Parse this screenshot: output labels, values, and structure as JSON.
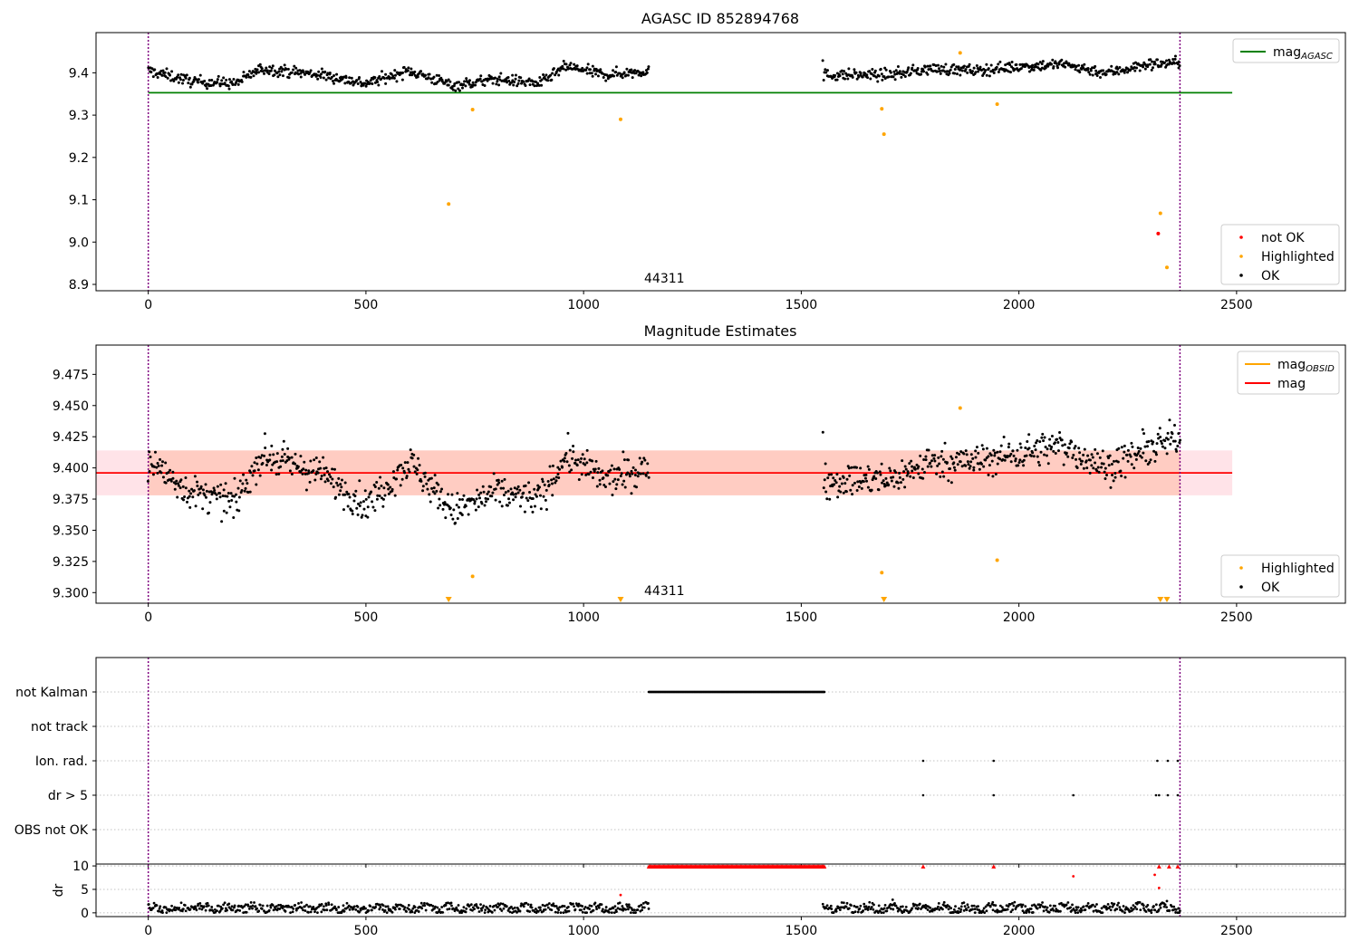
{
  "chart_data": [
    {
      "type": "scatter",
      "title": "AGASC ID 852894768",
      "xlabel": "",
      "ylabel": "",
      "xlim": [
        -120,
        2750
      ],
      "ylim": [
        8.885,
        9.495
      ],
      "xticks": [
        0,
        500,
        1000,
        1500,
        2000,
        2500
      ],
      "yticks": [
        8.9,
        9.0,
        9.1,
        9.2,
        9.3,
        9.4
      ],
      "ytick_labels": [
        "8.9",
        "9.0",
        "9.1",
        "9.2",
        "9.3",
        "9.4"
      ],
      "grid": false,
      "vlines": [
        0,
        2370
      ],
      "annotation": {
        "text": "44311",
        "x": 1180,
        "y": 8.905
      },
      "legends": [
        {
          "location": "upper right",
          "entries": [
            {
              "label": "mag",
              "subscript": "AGASC",
              "color": "#008000",
              "kind": "line"
            }
          ]
        },
        {
          "location": "lower right",
          "entries": [
            {
              "label": "not OK",
              "color": "#ff0000",
              "kind": "marker"
            },
            {
              "label": "Highlighted",
              "color": "#ffa500",
              "kind": "marker"
            },
            {
              "label": "OK",
              "color": "#000000",
              "kind": "marker"
            }
          ]
        }
      ],
      "hlines": [
        {
          "name": "mag_AGASC",
          "y": 9.353,
          "xrange": [
            0,
            2490
          ],
          "color": "#008000"
        }
      ],
      "series": [
        {
          "name": "OK",
          "color": "#000000",
          "kind": "scatter-dense",
          "segments": [
            {
              "x": [
                0,
                1150
              ],
              "y_anchors": [
                [
                  0,
                  9.405
                ],
                [
                  100,
                  9.38
                ],
                [
                  200,
                  9.375
                ],
                [
                  260,
                  9.41
                ],
                [
                  400,
                  9.395
                ],
                [
                  500,
                  9.375
                ],
                [
                  600,
                  9.405
                ],
                [
                  700,
                  9.37
                ],
                [
                  800,
                  9.385
                ],
                [
                  900,
                  9.375
                ],
                [
                  960,
                  9.415
                ],
                [
                  1050,
                  9.395
                ],
                [
                  1150,
                  9.405
                ]
              ],
              "spread": 0.012,
              "n": 620
            },
            {
              "x": [
                1550,
                2370
              ],
              "y_anchors": [
                [
                  1550,
                  9.395
                ],
                [
                  1700,
                  9.395
                ],
                [
                  1800,
                  9.41
                ],
                [
                  1900,
                  9.405
                ],
                [
                  2000,
                  9.415
                ],
                [
                  2100,
                  9.42
                ],
                [
                  2200,
                  9.4
                ],
                [
                  2300,
                  9.42
                ],
                [
                  2370,
                  9.425
                ]
              ],
              "spread": 0.012,
              "n": 440
            }
          ]
        },
        {
          "name": "Highlighted",
          "color": "#ffa500",
          "kind": "scatter",
          "x": [
            690,
            745,
            1085,
            1685,
            1690,
            1865,
            1950,
            2325,
            2340
          ],
          "y": [
            9.09,
            9.313,
            9.29,
            9.315,
            9.255,
            9.447,
            9.326,
            9.068,
            8.94
          ]
        },
        {
          "name": "not OK",
          "color": "#ff0000",
          "kind": "scatter",
          "x": [
            2320
          ],
          "y": [
            9.02
          ]
        }
      ]
    },
    {
      "type": "scatter",
      "title": "Magnitude Estimates",
      "xlabel": "",
      "ylabel": "",
      "xlim": [
        -120,
        2750
      ],
      "ylim": [
        9.2915,
        9.4985
      ],
      "xticks": [
        0,
        500,
        1000,
        1500,
        2000,
        2500
      ],
      "yticks": [
        9.3,
        9.325,
        9.35,
        9.375,
        9.4,
        9.425,
        9.45,
        9.475
      ],
      "ytick_labels": [
        "9.300",
        "9.325",
        "9.350",
        "9.375",
        "9.400",
        "9.425",
        "9.450",
        "9.475"
      ],
      "grid": false,
      "vlines": [
        0,
        2370
      ],
      "annotation": {
        "text": "44311",
        "x": 1180,
        "y": 9.296
      },
      "legends": [
        {
          "location": "upper right",
          "entries": [
            {
              "label": "mag",
              "subscript": "OBSID",
              "color": "#ffa500",
              "kind": "line"
            },
            {
              "label": "mag",
              "subscript": "",
              "color": "#ff0000",
              "kind": "line"
            }
          ]
        },
        {
          "location": "lower right",
          "entries": [
            {
              "label": "Highlighted",
              "color": "#ffa500",
              "kind": "marker"
            },
            {
              "label": "OK",
              "color": "#000000",
              "kind": "marker"
            }
          ]
        }
      ],
      "hlines": [
        {
          "name": "mag",
          "y": 9.396,
          "xrange": [
            -120,
            2490
          ],
          "color": "#ff0000"
        }
      ],
      "bands": [
        {
          "name": "mag_band",
          "y": [
            9.378,
            9.414
          ],
          "xrange": [
            -120,
            2490
          ],
          "color": "#ffc0cb",
          "opacity": 0.45
        },
        {
          "name": "mag_OBSID_band",
          "y": [
            9.378,
            9.414
          ],
          "xrange": [
            0,
            2370
          ],
          "color": "#ffa07a",
          "opacity": 0.35
        }
      ],
      "series": [
        {
          "name": "OK",
          "color": "#000000",
          "kind": "scatter-dense",
          "segments": [
            {
              "x": [
                0,
                1150
              ],
              "y_anchors": [
                [
                  0,
                  9.405
                ],
                [
                  100,
                  9.38
                ],
                [
                  200,
                  9.372
                ],
                [
                  260,
                  9.41
                ],
                [
                  400,
                  9.395
                ],
                [
                  500,
                  9.37
                ],
                [
                  600,
                  9.405
                ],
                [
                  700,
                  9.365
                ],
                [
                  800,
                  9.38
                ],
                [
                  900,
                  9.375
                ],
                [
                  960,
                  9.41
                ],
                [
                  1050,
                  9.39
                ],
                [
                  1150,
                  9.4
                ]
              ],
              "spread": 0.012,
              "n": 620
            },
            {
              "x": [
                1550,
                2370
              ],
              "y_anchors": [
                [
                  1550,
                  9.39
                ],
                [
                  1700,
                  9.39
                ],
                [
                  1800,
                  9.405
                ],
                [
                  1900,
                  9.405
                ],
                [
                  2000,
                  9.412
                ],
                [
                  2100,
                  9.418
                ],
                [
                  2200,
                  9.4
                ],
                [
                  2300,
                  9.415
                ],
                [
                  2370,
                  9.425
                ]
              ],
              "spread": 0.012,
              "n": 440
            }
          ]
        },
        {
          "name": "Highlighted",
          "color": "#ffa500",
          "kind": "scatter",
          "x": [
            745,
            1685,
            1865,
            1950
          ],
          "y": [
            9.313,
            9.316,
            9.448,
            9.326
          ]
        },
        {
          "name": "Highlighted (below range)",
          "color": "#ffa500",
          "kind": "triangle-down",
          "x": [
            690,
            1085,
            1690,
            2325,
            2340
          ],
          "y": [
            9.2935,
            9.2935,
            9.2935,
            9.2935,
            9.2935
          ]
        }
      ]
    },
    {
      "type": "scatter",
      "title": "",
      "xlabel": "",
      "ylabel": "",
      "xlim": [
        -120,
        2750
      ],
      "xticks": [
        0,
        500,
        1000,
        1500,
        2000,
        2500
      ],
      "categories": [
        "not Kalman",
        "not track",
        "Ion. rad.",
        "dr > 5",
        "OBS not OK"
      ],
      "grid": true,
      "vlines": [
        0,
        2370
      ],
      "flags": [
        {
          "category": "not Kalman",
          "x_range": [
            1150,
            1555
          ],
          "dense": true
        },
        {
          "category": "not track",
          "x": []
        },
        {
          "category": "Ion. rad.",
          "x": [
            1780,
            1942,
            2318,
            2342,
            2365
          ]
        },
        {
          "category": "dr > 5",
          "x": [
            1780,
            1942,
            2125,
            2315,
            2322,
            2342,
            2365
          ]
        },
        {
          "category": "OBS not OK",
          "x": []
        }
      ]
    },
    {
      "type": "scatter",
      "title": "",
      "xlabel": "",
      "ylabel": "dr",
      "xlim": [
        -120,
        2750
      ],
      "ylim": [
        -0.8,
        10.4
      ],
      "xticks": [
        0,
        500,
        1000,
        1500,
        2000,
        2500
      ],
      "yticks": [
        0,
        5,
        10
      ],
      "ytick_labels": [
        "0",
        "5",
        "10"
      ],
      "grid": true,
      "vlines": [
        0,
        2370
      ],
      "series": [
        {
          "name": "dr",
          "color": "#000000",
          "kind": "scatter-dense",
          "segments": [
            {
              "x": [
                0,
                1150
              ],
              "y_mean": 1.0,
              "spread": 0.9,
              "n": 580
            },
            {
              "x": [
                1550,
                2370
              ],
              "y_mean": 1.0,
              "spread": 0.9,
              "n": 420
            }
          ]
        },
        {
          "name": "dr > 10 (clipped)",
          "color": "#ff0000",
          "kind": "triangle-up",
          "x_range": [
            1150,
            1555
          ],
          "y": 9.85,
          "dense": true,
          "extra_x": [
            1780,
            1942,
            2322,
            2345,
            2365
          ]
        },
        {
          "name": "dr outliers",
          "color": "#ff0000",
          "kind": "scatter",
          "x": [
            1085,
            2125,
            2312,
            2322
          ],
          "y": [
            3.8,
            7.8,
            8.1,
            5.3
          ]
        },
        {
          "name": "dr black outliers",
          "color": "#000000",
          "kind": "scatter",
          "x": [
            1710,
            2340
          ],
          "y": [
            2.8,
            2.5
          ]
        }
      ]
    }
  ]
}
